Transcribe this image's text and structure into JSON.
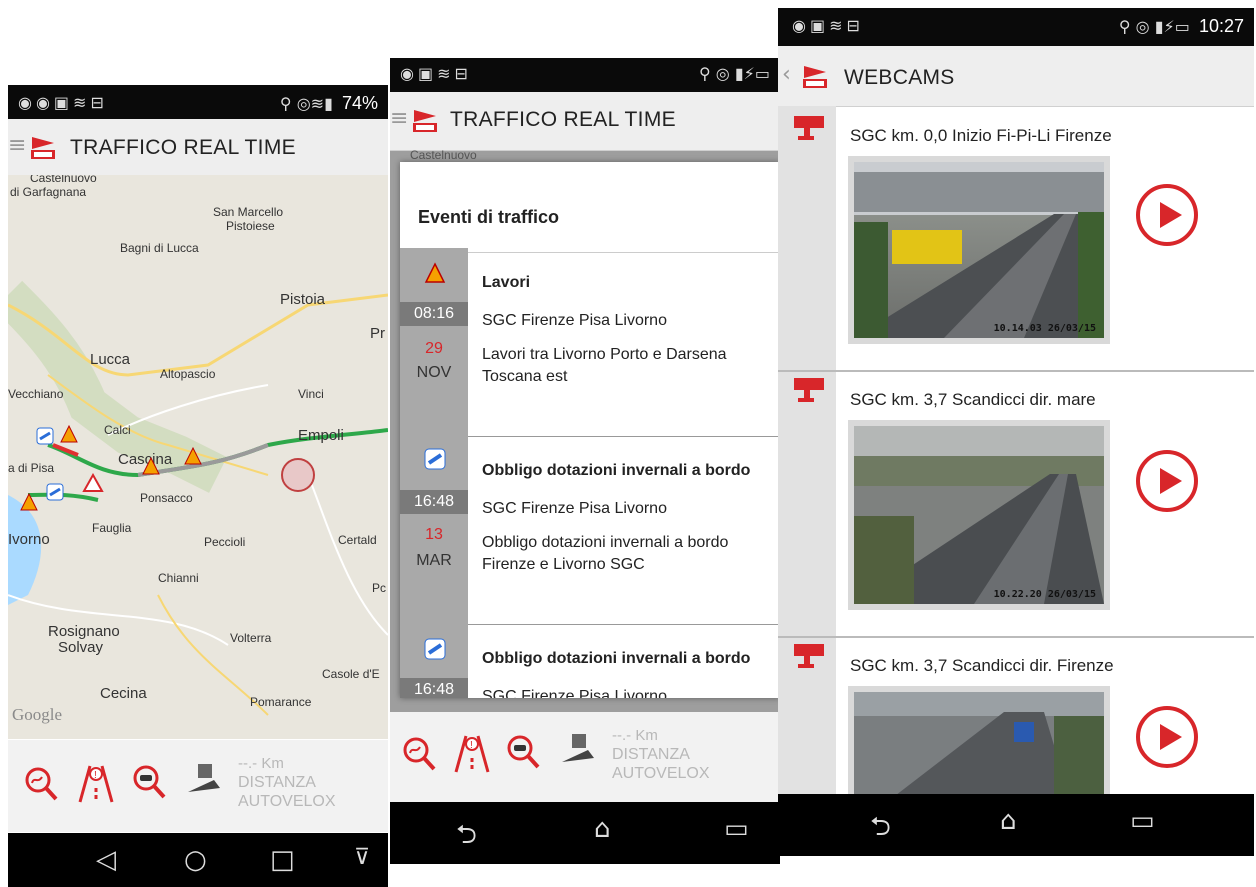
{
  "colors": {
    "accent": "#d8262a",
    "appbar": "#eeeeee",
    "sidebar_grey": "#a9a9a9"
  },
  "screen1": {
    "status_right": "74%",
    "title": "TRAFFICO REAL TIME",
    "map_labels": [
      "Castelnuovo",
      "di Garfagnana",
      "San Marcello",
      "Pistoiese",
      "Bagni di Lucca",
      "Pistoia",
      "Pr",
      "Lucca",
      "Altopascio",
      "Vecchiano",
      "Vinci",
      "Calci",
      "Empoli",
      "a di Pisa",
      "Cascina",
      "Ponsacco",
      "Ivorno",
      "Fauglia",
      "Peccioli",
      "Certald",
      "Chianni",
      "Pc",
      "Rosignano",
      "Solvay",
      "Volterra",
      "Casole d'E",
      "Cecina",
      "Pomarance",
      "Google"
    ],
    "distance_value": "--.- Km",
    "distance_line1": "DISTANZA",
    "distance_line2": "AUTOVELOX"
  },
  "screen2": {
    "title": "TRAFFICO REAL TIME",
    "behind_label": "Castelnuovo",
    "events_title": "Eventi di traffico",
    "events": [
      {
        "icon": "roadworks-icon",
        "time": "08:16",
        "day": "29",
        "month": "NOV",
        "title": "Lavori",
        "road": "SGC   Firenze Pisa Livorno",
        "desc": "Lavori  tra Livorno Porto e Darsena Toscana est"
      },
      {
        "icon": "snow-chains-icon",
        "time": "16:48",
        "day": "13",
        "month": "MAR",
        "title": "Obbligo dotazioni invernali a bordo",
        "road": "SGC   Firenze Pisa Livorno",
        "desc": "Obbligo dotazioni invernali a bordo Firenze e Livorno SGC"
      },
      {
        "icon": "snow-chains-icon",
        "time": "16:48",
        "title": "Obbligo dotazioni invernali a bordo",
        "road": "SGC   Firenze Pisa Livorno"
      }
    ],
    "distance_value": "--.- Km",
    "distance_line1": "DISTANZA",
    "distance_line2": "AUTOVELOX"
  },
  "screen3": {
    "time": "10:27",
    "title": "WEBCAMS",
    "webcams": [
      {
        "title": "SGC km. 0,0 Inizio Fi-Pi-Li Firenze",
        "timestamp": "10.14.03 26/03/15"
      },
      {
        "title": "SGC km. 3,7 Scandicci dir. mare",
        "timestamp": "10.22.20 26/03/15"
      },
      {
        "title": "SGC km. 3,7 Scandicci dir. Firenze"
      }
    ]
  }
}
